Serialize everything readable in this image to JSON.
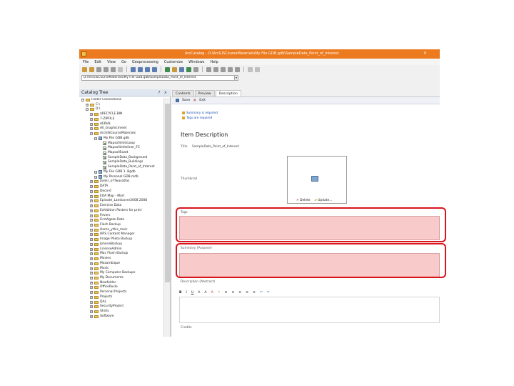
{
  "window": {
    "title": "ArcCatalog - D:\\ArcGISCourseMaterials\\My File GDB.gdb\\SampleData_Point_of_Interest",
    "close_glyph": "×"
  },
  "menu": [
    "File",
    "Edit",
    "View",
    "Go",
    "Geoprocessing",
    "Customize",
    "Windows",
    "Help"
  ],
  "location": {
    "path": "D:\\ArcGISCourseMaterials\\My File GDB.gdb\\SampleData_Point_of_Interest",
    "dropdown_glyph": "▾"
  },
  "catalog_tree": {
    "title": "Catalog Tree",
    "header_buttons": "? ×",
    "items": [
      {
        "label": "Folder Connections",
        "level": 0,
        "kind": "folder",
        "expander": "−"
      },
      {
        "label": "C:\\",
        "level": 1,
        "kind": "folder",
        "expander": "+"
      },
      {
        "label": "D:\\",
        "level": 1,
        "kind": "folder",
        "expander": "−"
      },
      {
        "label": "$RECYCLE.BIN",
        "level": 2,
        "kind": "folder",
        "expander": "+"
      },
      {
        "label": "7-ZIPFILE",
        "level": 2,
        "kind": "folder",
        "expander": "+"
      },
      {
        "label": "AERIAL",
        "level": 2,
        "kind": "folder",
        "expander": "+"
      },
      {
        "label": "All_Graphicimeet",
        "level": 2,
        "kind": "folder",
        "expander": "+"
      },
      {
        "label": "ArcGISCourseMaterials",
        "level": 2,
        "kind": "folder",
        "expander": "−"
      },
      {
        "label": "My File GDB.gdb",
        "level": 3,
        "kind": "gdb",
        "expander": "−"
      },
      {
        "label": "MapsollimitsLoop",
        "level": 4,
        "kind": "fc",
        "expander": ""
      },
      {
        "label": "Mapsollimitsliner_FC",
        "level": 4,
        "kind": "fc",
        "expander": ""
      },
      {
        "label": "MapsollSoatt",
        "level": 4,
        "kind": "fc",
        "expander": ""
      },
      {
        "label": "SampleData_Background",
        "level": 4,
        "kind": "fc",
        "expander": ""
      },
      {
        "label": "SampleData_Buildings",
        "level": 4,
        "kind": "fc",
        "expander": ""
      },
      {
        "label": "SampleData_Point_of_Interest",
        "level": 4,
        "kind": "fc",
        "expander": ""
      },
      {
        "label": "My File GDB 1 .Bgdb",
        "level": 3,
        "kind": "gdb",
        "expander": "+"
      },
      {
        "label": "My Personal GDB.mdb",
        "level": 3,
        "kind": "gdb",
        "expander": "+"
      },
      {
        "label": "bankr_of fwaxatlas",
        "level": 2,
        "kind": "folder",
        "expander": "+"
      },
      {
        "label": "DATA",
        "level": 2,
        "kind": "folder",
        "expander": "+"
      },
      {
        "label": "Decord",
        "level": 2,
        "kind": "folder",
        "expander": "+"
      },
      {
        "label": "EOA Map - Mart",
        "level": 2,
        "kind": "folder",
        "expander": "+"
      },
      {
        "label": "Episode_Landcover2008 2008",
        "level": 2,
        "kind": "folder",
        "expander": "+"
      },
      {
        "label": "Exercise Data",
        "level": 2,
        "kind": "folder",
        "expander": "+"
      },
      {
        "label": "Exhibition Posters for print",
        "level": 2,
        "kind": "folder",
        "expander": "+"
      },
      {
        "label": "Fevers",
        "level": 2,
        "kind": "folder",
        "expander": "+"
      },
      {
        "label": "FirstAgate Data",
        "level": 2,
        "kind": "folder",
        "expander": "+"
      },
      {
        "label": "Flash Backup",
        "level": 2,
        "kind": "folder",
        "expander": "+"
      },
      {
        "label": "Hama_ythis_meic",
        "level": 2,
        "kind": "folder",
        "expander": "+"
      },
      {
        "label": "HRS Content Manager",
        "level": 2,
        "kind": "folder",
        "expander": "+"
      },
      {
        "label": "Image Photo Backup",
        "level": 2,
        "kind": "folder",
        "expander": "+"
      },
      {
        "label": "IphoneBackup",
        "level": 2,
        "kind": "folder",
        "expander": "+"
      },
      {
        "label": "LicenseAdmin",
        "level": 2,
        "kind": "folder",
        "expander": "+"
      },
      {
        "label": "Mac Flash Backup",
        "level": 2,
        "kind": "folder",
        "expander": "+"
      },
      {
        "label": "Movies",
        "level": 2,
        "kind": "folder",
        "expander": "+"
      },
      {
        "label": "Mozambique",
        "level": 2,
        "kind": "folder",
        "expander": "+"
      },
      {
        "label": "Music",
        "level": 2,
        "kind": "folder",
        "expander": "+"
      },
      {
        "label": "My Computer Backups",
        "level": 2,
        "kind": "folder",
        "expander": "+"
      },
      {
        "label": "My Documents",
        "level": 2,
        "kind": "folder",
        "expander": "+"
      },
      {
        "label": "Newfolder",
        "level": 2,
        "kind": "folder",
        "expander": "+"
      },
      {
        "label": "OfficeRuslo",
        "level": 2,
        "kind": "folder",
        "expander": "+"
      },
      {
        "label": "Personal Projects",
        "level": 2,
        "kind": "folder",
        "expander": "+"
      },
      {
        "label": "Projects",
        "level": 2,
        "kind": "folder",
        "expander": "+"
      },
      {
        "label": "QAL",
        "level": 2,
        "kind": "folder",
        "expander": "+"
      },
      {
        "label": "SecurityProject",
        "level": 2,
        "kind": "folder",
        "expander": "+"
      },
      {
        "label": "Shirts",
        "level": 2,
        "kind": "folder",
        "expander": "+"
      },
      {
        "label": "Software",
        "level": 2,
        "kind": "folder",
        "expander": "+"
      }
    ]
  },
  "tabs": [
    {
      "label": "Contents",
      "active": false
    },
    {
      "label": "Preview",
      "active": false
    },
    {
      "label": "Description",
      "active": true
    }
  ],
  "edit_toolbar": {
    "save": "Save",
    "exit": "Exit"
  },
  "notices": [
    "Summary is required",
    "Tags are required"
  ],
  "item_description": {
    "heading": "Item Description",
    "title_label": "Title",
    "title_value": "SampleData_Point_of_Interest",
    "thumbnail_label": "Thumbnail",
    "delete_label": "Delete",
    "update_label": "Update...",
    "tags_label": "Tags",
    "summary_label": "Summary (Purpose)",
    "description_label": "Description (Abstract)",
    "credits_label": "Credits"
  },
  "rte_buttons": [
    "B",
    "I",
    "U",
    "A",
    "A",
    "A",
    "✎",
    "≡",
    "≡",
    "≡",
    "≡",
    "≡",
    "↶",
    "↷"
  ],
  "colors": {
    "title_bar": "#ec7a1e",
    "required_field_fill": "#f9caca",
    "highlight_outline": "#d8141c"
  }
}
